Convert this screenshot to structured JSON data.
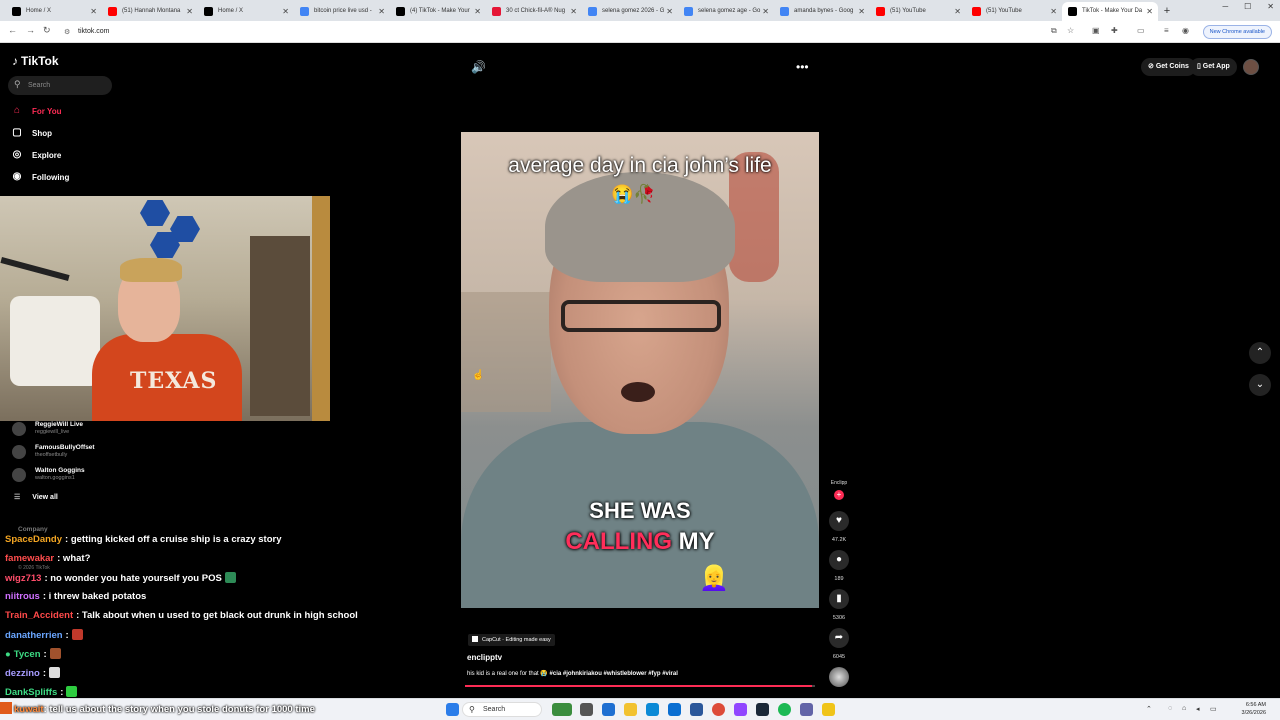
{
  "browser": {
    "tabs": [
      {
        "title": "Home / X",
        "icon": "x-icon",
        "color": "#000000"
      },
      {
        "title": "(51) Hannah Montana",
        "icon": "youtube-icon",
        "color": "#ff0000"
      },
      {
        "title": "Home / X",
        "icon": "x-icon",
        "color": "#000000"
      },
      {
        "title": "bitcoin price live usd -",
        "icon": "google-icon",
        "color": "#4285f4"
      },
      {
        "title": "(4) TikTok - Make Your",
        "icon": "tiktok-icon",
        "color": "#000000"
      },
      {
        "title": "30 ct Chick-fil-A® Nug",
        "icon": "chickfila-icon",
        "color": "#e51636"
      },
      {
        "title": "selena gomez 2026 - G",
        "icon": "google-icon",
        "color": "#4285f4"
      },
      {
        "title": "selena gomez age - Go",
        "icon": "google-icon",
        "color": "#4285f4"
      },
      {
        "title": "amanda bynes - Goog",
        "icon": "google-icon",
        "color": "#4285f4"
      },
      {
        "title": "(51) YouTube",
        "icon": "youtube-icon",
        "color": "#ff0000"
      },
      {
        "title": "(51) YouTube",
        "icon": "youtube-icon",
        "color": "#ff0000"
      },
      {
        "title": "TikTok - Make Your Da",
        "icon": "tiktok-icon",
        "color": "#000000",
        "active": true
      }
    ],
    "url": "tiktok.com",
    "update_label": "New Chrome available"
  },
  "tiktok": {
    "logo": "TikTok",
    "search_placeholder": "Search",
    "nav": [
      {
        "label": "For You",
        "icon": "home-icon",
        "active": true
      },
      {
        "label": "Shop",
        "icon": "bag-icon"
      },
      {
        "label": "Explore",
        "icon": "compass-icon"
      },
      {
        "label": "Following",
        "icon": "people-icon"
      }
    ],
    "following_accounts": [
      {
        "name": "ReggieWill Live",
        "handle": "reggiewill_live"
      },
      {
        "name": "FamousBullyOffset",
        "handle": "theoffsetbully"
      },
      {
        "name": "Walton Goggins",
        "handle": "walton.goggins1"
      }
    ],
    "view_all": "View all",
    "company": "Company",
    "copyright": "© 2026 TikTok",
    "get_coins": "Get Coins",
    "get_app": "Get App",
    "video": {
      "caption_top": "average day in cia john’s life",
      "caption_emoji": "😭🥀",
      "caption_line1": "SHE WAS",
      "caption_line2_red": "CALLING",
      "caption_line2_white": "MY",
      "caption_emoji2": "👱‍♀️",
      "capcut_label": "CapCut · Editing made easy",
      "author": "enclipptv",
      "description": "his kid is a real one for that 😭",
      "hashtags": "#cia #johnkiriakou #whistleblower #fyp #viral",
      "progress": 0.99
    },
    "rail": {
      "handle": "Enclipp",
      "likes": "47.2K",
      "comments": "189",
      "saves": "5306",
      "shares": "6045"
    }
  },
  "stream_chat": [
    {
      "user": "SpaceDandy",
      "color": "#f4a623",
      "text": ": getting kicked off a cruise ship is a crazy story"
    },
    {
      "user": "famewakar",
      "color": "#ff4d4d",
      "text": ": what?"
    },
    {
      "user": "wigz713",
      "color": "#ff4d6a",
      "text": ": no wonder you hate yourself you POS",
      "emote": "#2e8b57"
    },
    {
      "user": "niitrous",
      "color": "#d070ff",
      "text": ": i threw baked potatos"
    },
    {
      "user": "Train_Accident",
      "color": "#ff4a4a",
      "text": ": Talk about when u used to get black out drunk in high school"
    },
    {
      "user": "danatherrien",
      "color": "#6aa6ff",
      "text": ":",
      "emote": "#c0392b"
    },
    {
      "user": "Tycen",
      "color": "#3ddc84",
      "text": ":",
      "emote": "#a0522d",
      "badge": true
    },
    {
      "user": "dezzino",
      "color": "#a79cff",
      "text": ":",
      "emote": "#dddddd"
    },
    {
      "user": "DankSpliffs",
      "color": "#3ddc84",
      "text": ":",
      "emote": "#2ecc40"
    }
  ],
  "bottom_chat": {
    "user": "kuwait",
    "text": ": tell us about the story when you stole donuts for 1000 time"
  },
  "taskbar": {
    "search_label": "Search",
    "time": "6:56 AM",
    "date": "3/26/2026"
  }
}
